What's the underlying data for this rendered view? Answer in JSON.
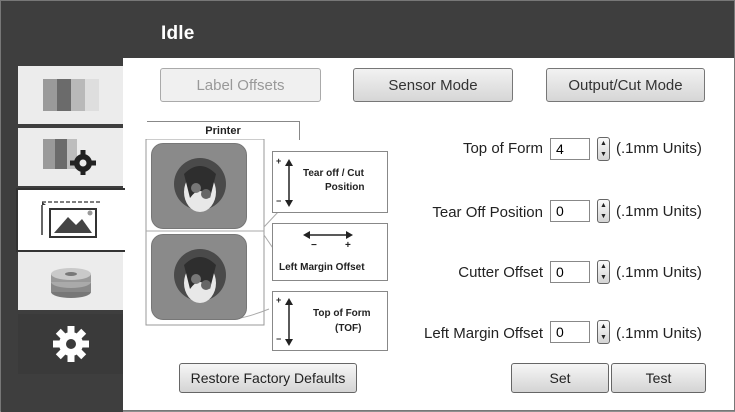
{
  "header": {
    "status": "Idle"
  },
  "sidebar": {
    "items": [
      {
        "icon": "color-bars-icon"
      },
      {
        "icon": "color-settings-icon"
      },
      {
        "icon": "label-image-icon",
        "active": true
      },
      {
        "icon": "media-roll-icon"
      },
      {
        "icon": "gear-icon"
      }
    ]
  },
  "tabs": {
    "label_offsets": "Label Offsets",
    "sensor_mode": "Sensor Mode",
    "output_cut_mode": "Output/Cut Mode"
  },
  "diagram": {
    "printer": "Printer",
    "tear_off_cut": "Tear off / Cut",
    "position": "Position",
    "left_margin_offset": "Left Margin Offset",
    "top_of_form": "Top of Form",
    "tof": "(TOF)",
    "plus": "+",
    "minus": "−"
  },
  "fields": {
    "top_of_form": {
      "label": "Top of Form",
      "value": "4",
      "unit": "(.1mm Units)"
    },
    "tear_off_position": {
      "label": "Tear Off Position",
      "value": "0",
      "unit": "(.1mm Units)"
    },
    "cutter_offset": {
      "label": "Cutter Offset",
      "value": "0",
      "unit": "(.1mm Units)"
    },
    "left_margin_offset": {
      "label": "Left Margin Offset",
      "value": "0",
      "unit": "(.1mm Units)"
    }
  },
  "buttons": {
    "restore": "Restore Factory Defaults",
    "set": "Set",
    "test": "Test"
  }
}
